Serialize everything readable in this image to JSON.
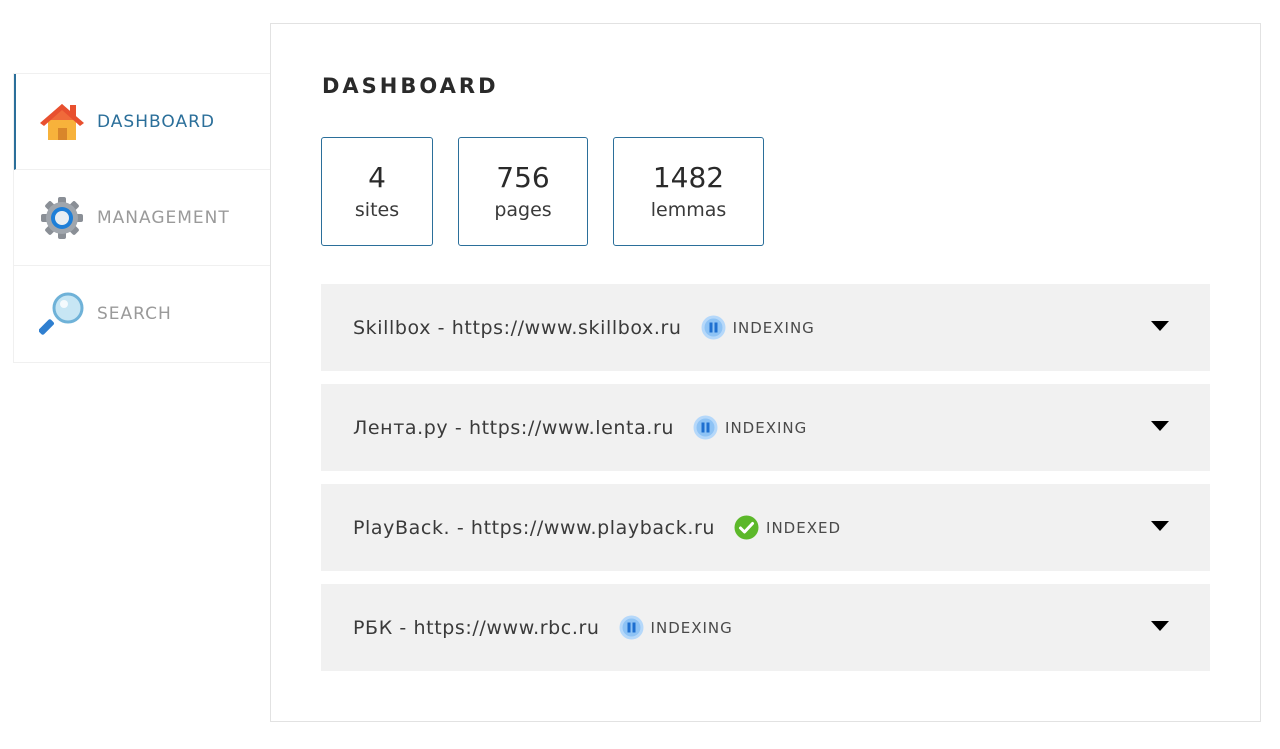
{
  "sidebar": {
    "items": [
      {
        "label": "DASHBOARD",
        "icon": "house-icon",
        "active": true
      },
      {
        "label": "MANAGEMENT",
        "icon": "gear-icon",
        "active": false
      },
      {
        "label": "SEARCH",
        "icon": "magnifier-icon",
        "active": false
      }
    ]
  },
  "main": {
    "title": "DASHBOARD",
    "stats": [
      {
        "value": "4",
        "label": "sites"
      },
      {
        "value": "756",
        "label": "pages"
      },
      {
        "value": "1482",
        "label": "lemmas"
      }
    ],
    "sites": [
      {
        "name": "Skillbox - https://www.skillbox.ru",
        "status": "INDEXING",
        "status_icon": "pause-icon"
      },
      {
        "name": "Лента.ру - https://www.lenta.ru",
        "status": "INDEXING",
        "status_icon": "pause-icon"
      },
      {
        "name": "PlayBack. - https://www.playback.ru",
        "status": "INDEXED",
        "status_icon": "check-icon"
      },
      {
        "name": "РБК - https://www.rbc.ru",
        "status": "INDEXING",
        "status_icon": "pause-icon"
      }
    ]
  },
  "colors": {
    "accent": "#2b6f9a",
    "row_bg": "#f1f1f1",
    "indexing_blue": "#8ec3f5",
    "indexed_green": "#5cb82a"
  }
}
